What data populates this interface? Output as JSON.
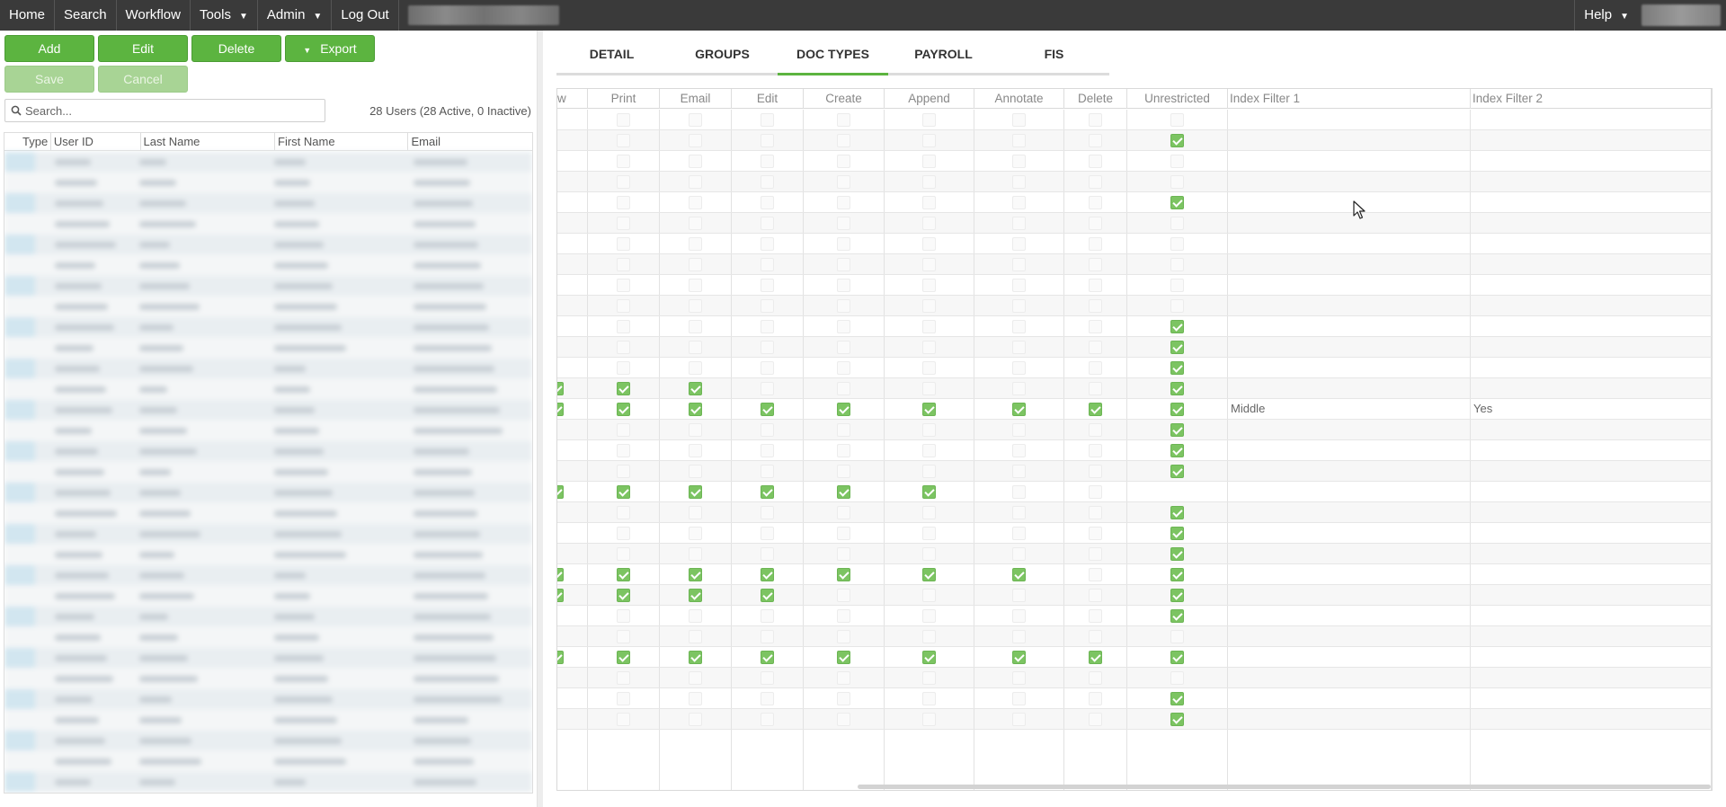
{
  "nav": {
    "items": [
      {
        "label": "Home"
      },
      {
        "label": "Search"
      },
      {
        "label": "Workflow"
      },
      {
        "label": "Tools",
        "dropdown": true
      },
      {
        "label": "Admin",
        "dropdown": true
      },
      {
        "label": "Log Out"
      }
    ],
    "help": {
      "label": "Help"
    }
  },
  "toolbar": {
    "add_label": "Add",
    "edit_label": "Edit",
    "delete_label": "Delete",
    "export_label": "Export",
    "save_label": "Save",
    "cancel_label": "Cancel"
  },
  "search": {
    "placeholder": "Search...",
    "value": ""
  },
  "user_count": "28 Users (28 Active, 0 Inactive)",
  "users_table": {
    "columns": [
      "Type",
      "User ID",
      "Last Name",
      "First Name",
      "Email"
    ]
  },
  "tabs": [
    {
      "label": "DETAIL",
      "active": false
    },
    {
      "label": "GROUPS",
      "active": false
    },
    {
      "label": "DOC TYPES",
      "active": true
    },
    {
      "label": "PAYROLL",
      "active": false
    },
    {
      "label": "FIS",
      "active": false
    }
  ],
  "perm_table": {
    "columns": [
      "w",
      "Print",
      "Email",
      "Edit",
      "Create",
      "Append",
      "Annotate",
      "Delete",
      "Unrestricted",
      "Index Filter 1",
      "Index Filter 2"
    ],
    "rows": [
      {
        "checks": [
          0,
          0,
          0,
          0,
          0,
          0,
          0,
          0,
          0
        ],
        "filter1": "",
        "filter2": ""
      },
      {
        "checks": [
          0,
          0,
          0,
          0,
          0,
          0,
          0,
          0,
          1
        ],
        "filter1": "",
        "filter2": ""
      },
      {
        "checks": [
          0,
          0,
          0,
          0,
          0,
          0,
          0,
          0,
          0
        ],
        "filter1": "",
        "filter2": ""
      },
      {
        "checks": [
          0,
          0,
          0,
          0,
          0,
          0,
          0,
          0,
          0
        ],
        "filter1": "",
        "filter2": ""
      },
      {
        "checks": [
          0,
          0,
          0,
          0,
          0,
          0,
          0,
          0,
          1
        ],
        "filter1": "",
        "filter2": ""
      },
      {
        "checks": [
          0,
          0,
          0,
          0,
          0,
          0,
          0,
          0,
          0
        ],
        "filter1": "",
        "filter2": ""
      },
      {
        "checks": [
          0,
          0,
          0,
          0,
          0,
          0,
          0,
          0,
          0
        ],
        "filter1": "",
        "filter2": ""
      },
      {
        "checks": [
          0,
          0,
          0,
          0,
          0,
          0,
          0,
          0,
          0
        ],
        "filter1": "",
        "filter2": ""
      },
      {
        "checks": [
          0,
          0,
          0,
          0,
          0,
          0,
          0,
          0,
          0
        ],
        "filter1": "",
        "filter2": ""
      },
      {
        "checks": [
          0,
          0,
          0,
          0,
          0,
          0,
          0,
          0,
          0
        ],
        "filter1": "",
        "filter2": ""
      },
      {
        "checks": [
          0,
          0,
          0,
          0,
          0,
          0,
          0,
          0,
          1
        ],
        "filter1": "",
        "filter2": ""
      },
      {
        "checks": [
          0,
          0,
          0,
          0,
          0,
          0,
          0,
          0,
          1
        ],
        "filter1": "",
        "filter2": ""
      },
      {
        "checks": [
          0,
          0,
          0,
          0,
          0,
          0,
          0,
          0,
          1
        ],
        "filter1": "",
        "filter2": ""
      },
      {
        "checks": [
          1,
          1,
          1,
          0,
          0,
          0,
          0,
          0,
          1
        ],
        "filter1": "",
        "filter2": ""
      },
      {
        "checks": [
          1,
          1,
          1,
          1,
          1,
          1,
          1,
          1,
          1
        ],
        "filter1": "Middle",
        "filter2": "Yes"
      },
      {
        "checks": [
          0,
          0,
          0,
          0,
          0,
          0,
          0,
          0,
          1
        ],
        "filter1": "",
        "filter2": ""
      },
      {
        "checks": [
          0,
          0,
          0,
          0,
          0,
          0,
          0,
          0,
          1
        ],
        "filter1": "",
        "filter2": ""
      },
      {
        "checks": [
          0,
          0,
          0,
          0,
          0,
          0,
          0,
          0,
          1
        ],
        "filter1": "",
        "filter2": ""
      },
      {
        "checks": [
          1,
          1,
          1,
          1,
          1,
          1,
          0,
          0,
          0
        ],
        "filter1": "",
        "filter2": ""
      },
      {
        "checks": [
          0,
          0,
          0,
          0,
          0,
          0,
          0,
          0,
          1
        ],
        "filter1": "",
        "filter2": ""
      },
      {
        "checks": [
          0,
          0,
          0,
          0,
          0,
          0,
          0,
          0,
          1
        ],
        "filter1": "",
        "filter2": ""
      },
      {
        "checks": [
          0,
          0,
          0,
          0,
          0,
          0,
          0,
          0,
          1
        ],
        "filter1": "",
        "filter2": ""
      },
      {
        "checks": [
          1,
          1,
          1,
          1,
          1,
          1,
          1,
          0,
          1
        ],
        "filter1": "",
        "filter2": ""
      },
      {
        "checks": [
          1,
          1,
          1,
          1,
          0,
          0,
          0,
          0,
          1
        ],
        "filter1": "",
        "filter2": ""
      },
      {
        "checks": [
          0,
          0,
          0,
          0,
          0,
          0,
          0,
          0,
          1
        ],
        "filter1": "",
        "filter2": ""
      },
      {
        "checks": [
          0,
          0,
          0,
          0,
          0,
          0,
          0,
          0,
          0
        ],
        "filter1": "",
        "filter2": ""
      },
      {
        "checks": [
          1,
          1,
          1,
          1,
          1,
          1,
          1,
          1,
          1
        ],
        "filter1": "",
        "filter2": ""
      },
      {
        "checks": [
          0,
          0,
          0,
          0,
          0,
          0,
          0,
          0,
          0
        ],
        "filter1": "",
        "filter2": ""
      },
      {
        "checks": [
          0,
          0,
          0,
          0,
          0,
          0,
          0,
          0,
          1
        ],
        "filter1": "",
        "filter2": ""
      },
      {
        "checks": [
          0,
          0,
          0,
          0,
          0,
          0,
          0,
          0,
          1
        ],
        "filter1": "",
        "filter2": ""
      }
    ]
  },
  "colors": {
    "accent": "#5cb440",
    "check_on": "#7cc462",
    "nav_bg": "#3a3a3a"
  }
}
